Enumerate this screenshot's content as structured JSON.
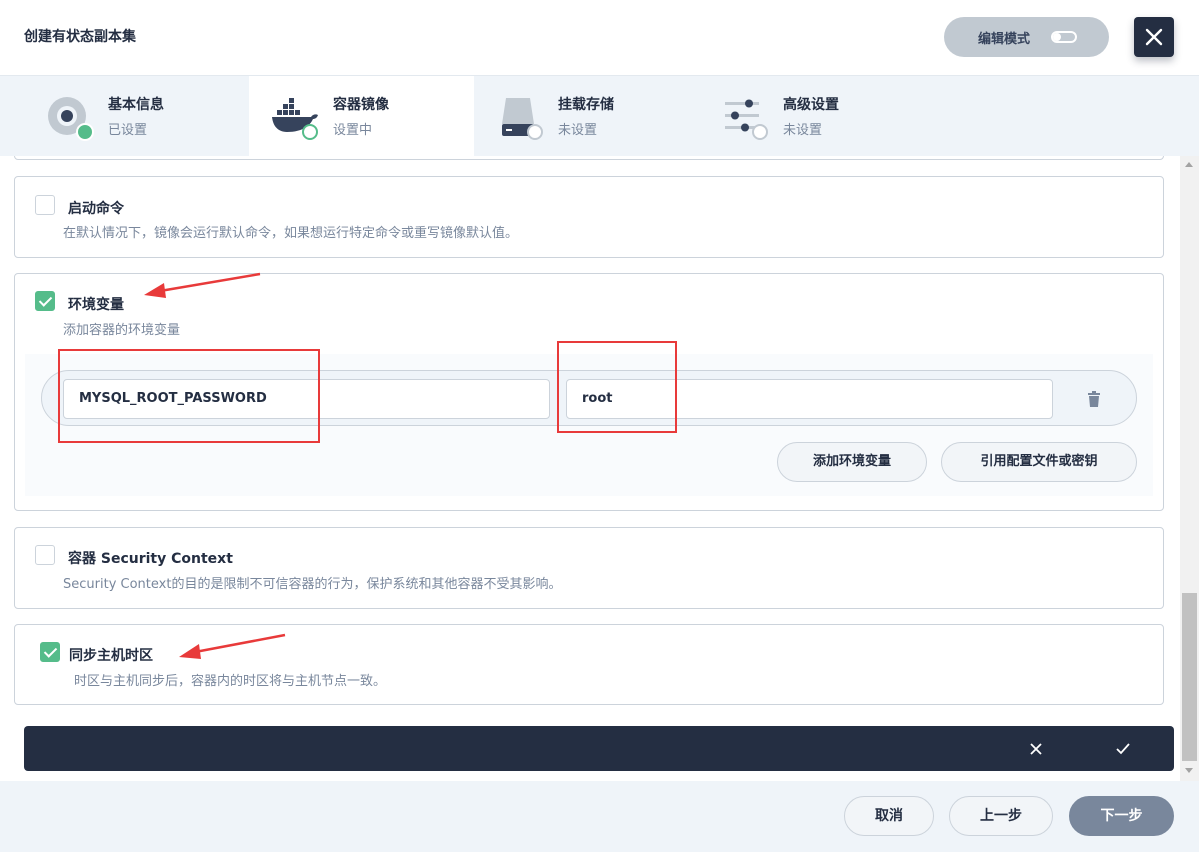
{
  "header": {
    "title": "创建有状态副本集",
    "edit_mode_label": "编辑模式"
  },
  "steps": [
    {
      "name": "基本信息",
      "state": "已设置"
    },
    {
      "name": "容器镜像",
      "state": "设置中"
    },
    {
      "name": "挂载存储",
      "state": "未设置"
    },
    {
      "name": "高级设置",
      "state": "未设置"
    }
  ],
  "start_command": {
    "title": "启动命令",
    "description": "在默认情况下，镜像会运行默认命令，如果想运行特定命令或重写镜像默认值。",
    "checked": false
  },
  "env_vars": {
    "title": "环境变量",
    "description": "添加容器的环境变量",
    "checked": true,
    "key_value": "MYSQL_ROOT_PASSWORD",
    "value_value": "root",
    "add_button": "添加环境变量",
    "ref_button": "引用配置文件或密钥"
  },
  "security_context": {
    "title": "容器 Security Context",
    "description": "Security Context的目的是限制不可信容器的行为，保护系统和其他容器不受其影响。",
    "checked": false
  },
  "sync_timezone": {
    "title": "同步主机时区",
    "description": "时区与主机同步后，容器内的时区将与主机节点一致。",
    "checked": true
  },
  "footer": {
    "cancel": "取消",
    "prev": "上一步",
    "next": "下一步"
  },
  "colors": {
    "accent_green": "#55bc8a",
    "dark": "#242e42",
    "annotation_red": "#e83a3a"
  }
}
